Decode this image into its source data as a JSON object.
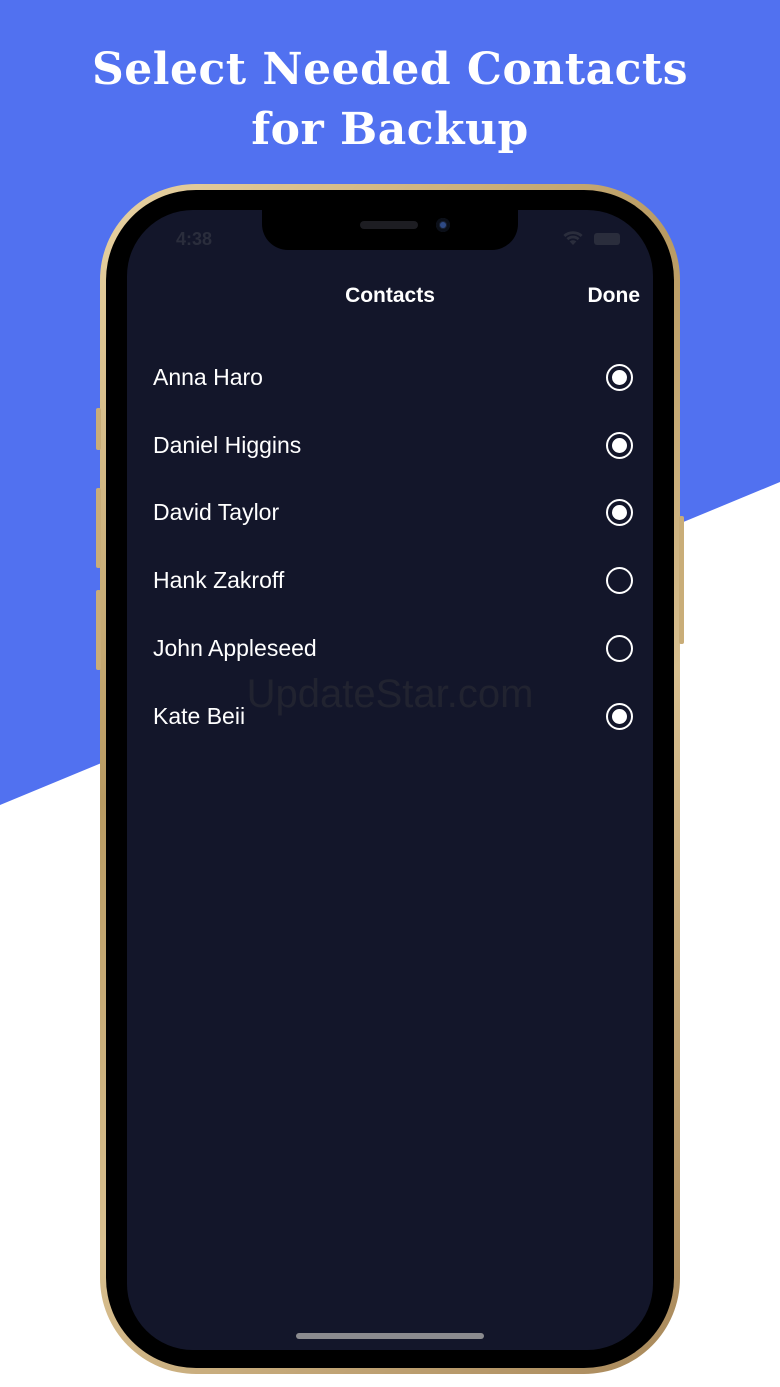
{
  "headline": {
    "line1": "Select Needed Contacts",
    "line2": "for Backup"
  },
  "colors": {
    "brand_blue": "#5171f0",
    "screen_bg": "#13162a",
    "text": "#ffffff"
  },
  "status_bar": {
    "time": "4:38",
    "icons": [
      "wifi-icon",
      "battery-icon"
    ]
  },
  "nav": {
    "title": "Contacts",
    "done_label": "Done"
  },
  "contacts": [
    {
      "name": "Anna Haro",
      "selected": true
    },
    {
      "name": "Daniel Higgins",
      "selected": true
    },
    {
      "name": "David Taylor",
      "selected": true
    },
    {
      "name": "Hank Zakroff",
      "selected": false
    },
    {
      "name": "John Appleseed",
      "selected": false
    },
    {
      "name": "Kate Beii",
      "selected": true
    }
  ],
  "watermark": "UpdateStar.com"
}
